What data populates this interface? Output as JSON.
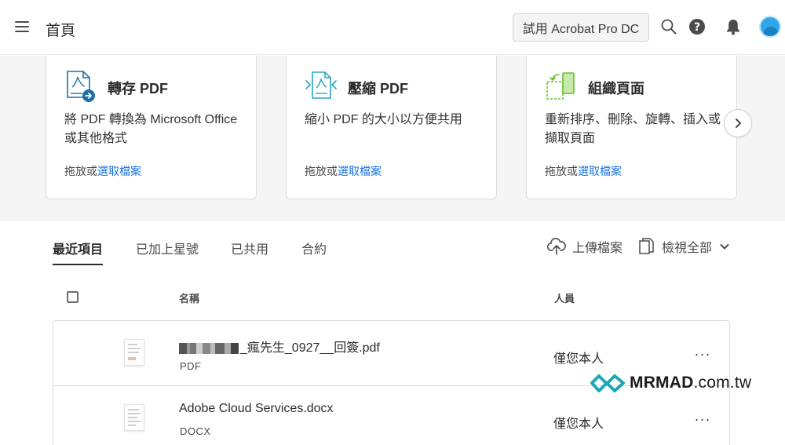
{
  "header": {
    "page_title": "首頁",
    "trial_button": "試用 Acrobat Pro DC"
  },
  "tools": [
    {
      "title": "轉存 PDF",
      "desc": "將 PDF 轉換為 Microsoft Office 或其他格式",
      "drop_text": "拖放或",
      "drop_link": "選取檔案"
    },
    {
      "title": "壓縮 PDF",
      "desc": "縮小 PDF 的大小以方便共用",
      "drop_text": "拖放或",
      "drop_link": "選取檔案"
    },
    {
      "title": "組織頁面",
      "desc": "重新排序、刪除、旋轉、插入或擷取頁面",
      "drop_text": "拖放或",
      "drop_link": "選取檔案"
    }
  ],
  "tabs": [
    "最近項目",
    "已加上星號",
    "已共用",
    "合約"
  ],
  "actions": {
    "upload": "上傳檔案",
    "view_all": "檢視全部"
  },
  "table": {
    "col_name": "名稱",
    "col_people": "人員",
    "rows": [
      {
        "name": "_瘋先生_0927__回簽.pdf",
        "type": "PDF",
        "people": "僅您本人"
      },
      {
        "name": "Adobe Cloud Services.docx",
        "type": "DOCX",
        "people": "僅您本人"
      }
    ]
  },
  "watermark": {
    "brand": "MRMAD",
    "domain": ".com.tw"
  },
  "colors": {
    "link": "#1473e6",
    "avatar": "#2fa7e6",
    "export_icon": "#1d6fa5",
    "compress_icon": "#2aa4c7",
    "organize_icon": "#6cbf2f"
  }
}
